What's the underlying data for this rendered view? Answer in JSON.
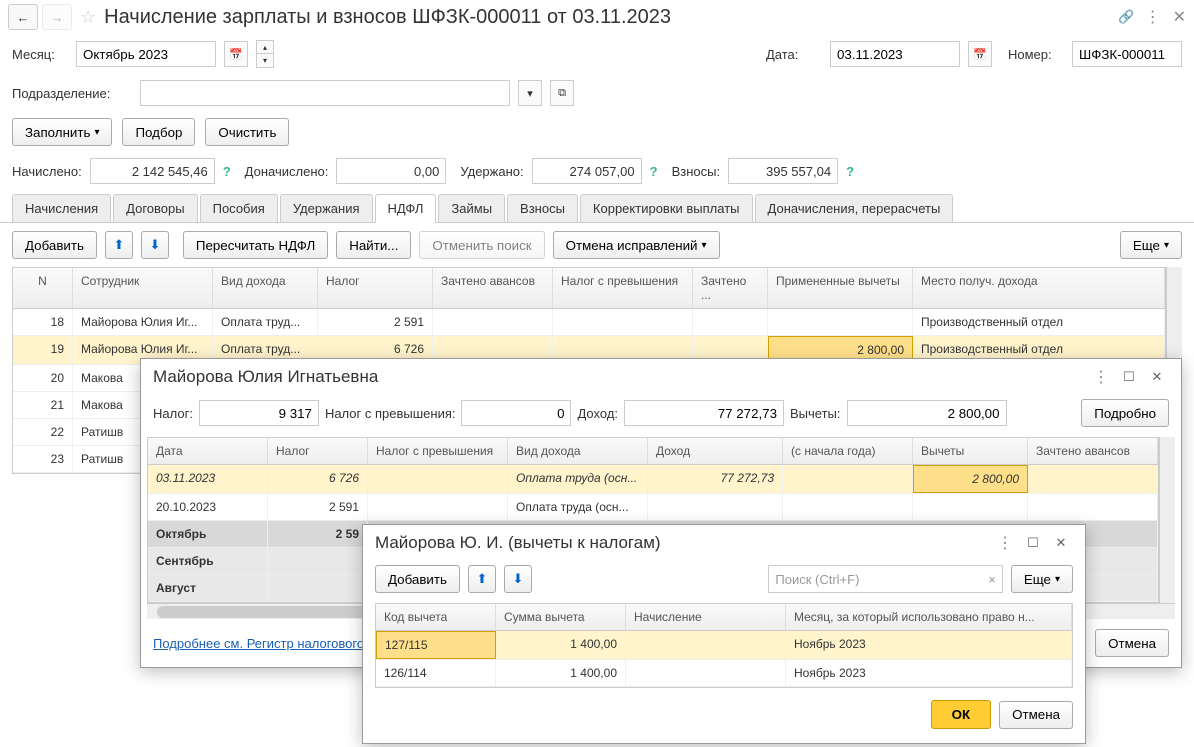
{
  "header": {
    "title": "Начисление зарплаты и взносов ШФЗК-000011 от 03.11.2023"
  },
  "form": {
    "month_label": "Месяц:",
    "month_value": "Октябрь 2023",
    "date_label": "Дата:",
    "date_value": "03.11.2023",
    "number_label": "Номер:",
    "number_value": "ШФЗК-000011",
    "dept_label": "Подразделение:",
    "dept_value": ""
  },
  "buttons": {
    "fill": "Заполнить",
    "pick": "Подбор",
    "clear": "Очистить",
    "add": "Добавить",
    "recalc": "Пересчитать НДФЛ",
    "find": "Найти...",
    "cancel_search": "Отменить поиск",
    "cancel_fixes": "Отмена исправлений",
    "more": "Еще",
    "more2": "Еще",
    "more3": "Еще",
    "detail": "Подробно",
    "ok": "ОК",
    "cancel": "Отмена",
    "cancel2": "Отмена"
  },
  "totals": {
    "accrued_label": "Начислено:",
    "accrued_value": "2 142 545,46",
    "addl_label": "Доначислено:",
    "addl_value": "0,00",
    "withheld_label": "Удержано:",
    "withheld_value": "274 057,00",
    "contrib_label": "Взносы:",
    "contrib_value": "395 557,04"
  },
  "tabs": {
    "t1": "Начисления",
    "t2": "Договоры",
    "t3": "Пособия",
    "t4": "Удержания",
    "t5": "НДФЛ",
    "t6": "Займы",
    "t7": "Взносы",
    "t8": "Корректировки выплаты",
    "t9": "Доначисления, перерасчеты"
  },
  "main_cols": {
    "c1": "N",
    "c2": "Сотрудник",
    "c3": "Вид дохода",
    "c4": "Налог",
    "c5": "Зачтено авансов",
    "c6": "Налог с превышения",
    "c7": "Зачтено ...",
    "c8": "Примененные вычеты",
    "c9": "Место получ. дохода"
  },
  "main_rows": [
    {
      "n": "18",
      "emp": "Майорова Юлия Иг...",
      "kind": "Оплата труд...",
      "tax": "2 591",
      "deduct": "",
      "place": "Производственный отдел"
    },
    {
      "n": "19",
      "emp": "Майорова Юлия Иг...",
      "kind": "Оплата труд...",
      "tax": "6 726",
      "deduct": "2 800,00",
      "place": "Производственный отдел",
      "hl": true
    },
    {
      "n": "20",
      "emp": "Макова"
    },
    {
      "n": "21",
      "emp": "Макова"
    },
    {
      "n": "22",
      "emp": "Ратишв"
    },
    {
      "n": "23",
      "emp": "Ратишв"
    }
  ],
  "popup1": {
    "title": "Майорова Юлия Игнатьевна",
    "tax_label": "Налог:",
    "tax_value": "9 317",
    "exc_label": "Налог с превышения:",
    "exc_value": "0",
    "income_label": "Доход:",
    "income_value": "77 272,73",
    "deduct_label": "Вычеты:",
    "deduct_value": "2 800,00",
    "cols": {
      "c1": "Дата",
      "c2": "Налог",
      "c3": "Налог с превышения",
      "c4": "Вид дохода",
      "c5": "Доход",
      "c6": "(с начала года)",
      "c7": "Вычеты",
      "c8": "Зачтено авансов"
    },
    "rows": [
      {
        "date": "03.11.2023",
        "tax": "6 726",
        "kind": "Оплата труда (осн...",
        "income": "77 272,73",
        "deduct": "2 800,00",
        "hl": true,
        "italic": true
      },
      {
        "date": "20.10.2023",
        "tax": "2 591",
        "kind": "Оплата труда (осн..."
      }
    ],
    "months": [
      {
        "m": "Октябрь",
        "tax": "2 59",
        "total": true
      },
      {
        "m": "Сентябрь"
      },
      {
        "m": "Август"
      }
    ],
    "link": "Подробнее см. Регистр налогового"
  },
  "popup2": {
    "title": "Майорова Ю. И. (вычеты к налогам)",
    "search_placeholder": "Поиск (Ctrl+F)",
    "cols": {
      "c1": "Код вычета",
      "c2": "Сумма вычета",
      "c3": "Начисление",
      "c4": "Месяц, за который использовано право н..."
    },
    "rows": [
      {
        "code": "127/115",
        "sum": "1 400,00",
        "month": "Ноябрь 2023",
        "hl": true
      },
      {
        "code": "126/114",
        "sum": "1 400,00",
        "month": "Ноябрь 2023"
      }
    ]
  }
}
